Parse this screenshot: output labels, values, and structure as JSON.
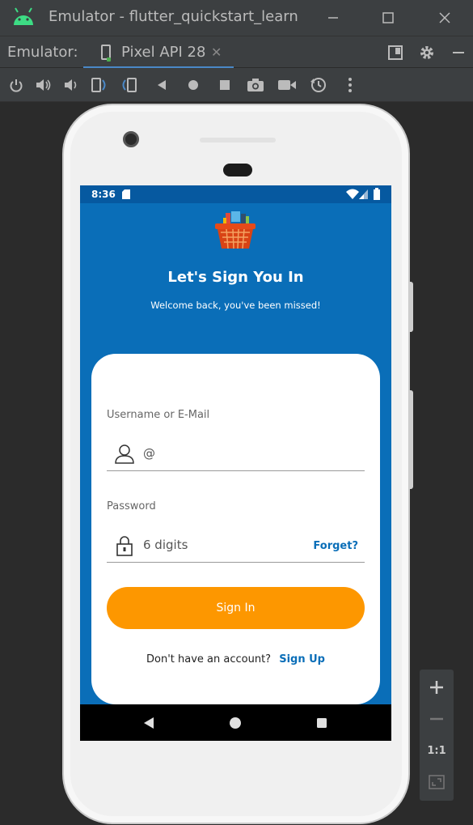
{
  "window": {
    "title": "Emulator - flutter_quickstart_learn"
  },
  "tabbar": {
    "label": "Emulator:",
    "tab_name": "Pixel API 28"
  },
  "device": {
    "status_time": "8:36",
    "app": {
      "headline": "Let's Sign You In",
      "subline": "Welcome back, you've been missed!",
      "username": {
        "label": "Username or E-Mail",
        "value": "@"
      },
      "password": {
        "label": "Password",
        "value": "6 digits",
        "forget": "Forget?"
      },
      "signin_button": "Sign In",
      "signup_prompt": "Don't have an account?",
      "signup_link": "Sign Up"
    }
  },
  "zoom": {
    "ratio": "1:1"
  },
  "colors": {
    "primary_blue": "#0a6eb8",
    "button_orange": "#fd9700",
    "ide_background": "#2b2b2b",
    "ide_panel": "#3c3f41"
  }
}
